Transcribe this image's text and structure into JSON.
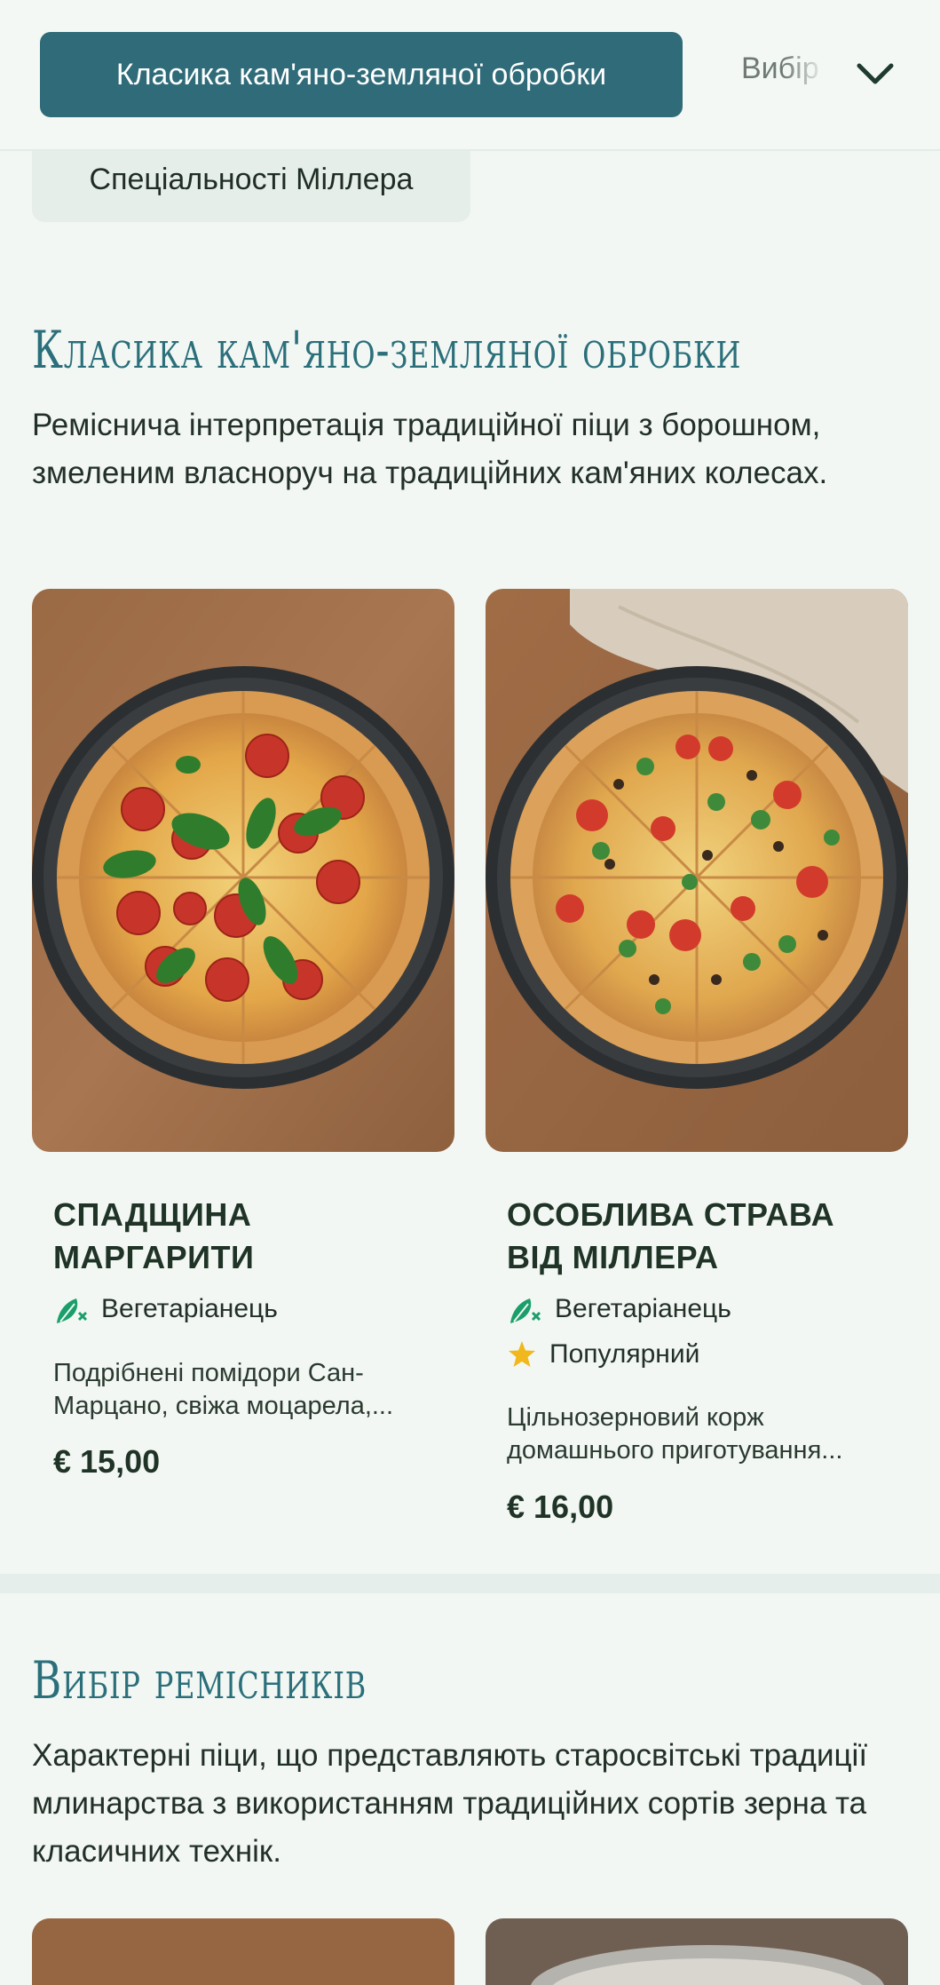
{
  "tabs": {
    "active_label": "Класика кам'яно-земляної обробки",
    "next_label": "Вибір",
    "chip_label": "Спеціальності Міллера"
  },
  "section1": {
    "title": "Класика кам'яно-земляної обробки",
    "description": "Реміснича інтерпретація традиційної піци з борошном, змеленим власноруч на традиційних кам'яних колесах.",
    "items": [
      {
        "name": "СПАДЩИНА МАРГАРИТИ",
        "tags": [
          "Вегетаріанець"
        ],
        "description": "Подрібнені помідори Сан-Марцано, свіжа моцарела,...",
        "price": "€ 15,00"
      },
      {
        "name": "ОСОБЛИВА СТРАВА ВІД МІЛЛЕРА",
        "tags": [
          "Вегетаріанець",
          "Популярний"
        ],
        "description": "Цільнозерновий корж домашнього приготування...",
        "price": "€ 16,00"
      }
    ]
  },
  "section2": {
    "title": "Вибір ремісників",
    "description": "Характерні піци, що представляють старосвітські традиції млинарства з використанням традиційних сортів зерна та класичних технік."
  },
  "colors": {
    "accent": "#2f6b78",
    "title": "#2b6f7b",
    "veg_icon": "#1a9e6a",
    "star": "#f0b81c"
  },
  "icons": [
    "chevron-down-icon",
    "vegetarian-icon",
    "star-icon"
  ]
}
